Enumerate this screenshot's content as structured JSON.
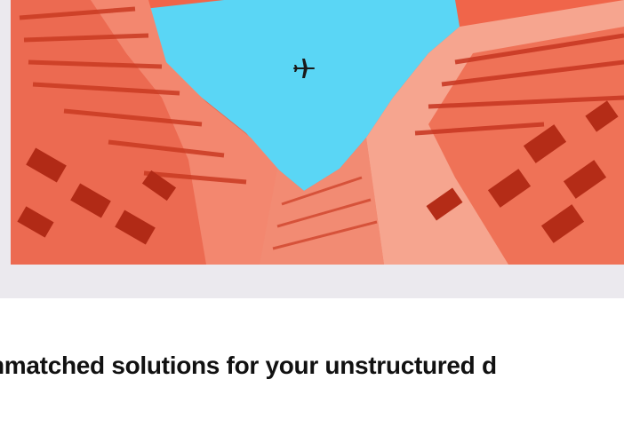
{
  "hero": {
    "image_subject": "looking up between red apartment towers at a blue sky with an airplane",
    "image_icon": "airplane-icon",
    "colors": {
      "sky": "#5ad6f5",
      "building_light": "#f4836a",
      "building_dark": "#c8341f",
      "band": "#ebe9ee"
    }
  },
  "headline": {
    "text": "nmatched solutions for your unstructured d"
  }
}
